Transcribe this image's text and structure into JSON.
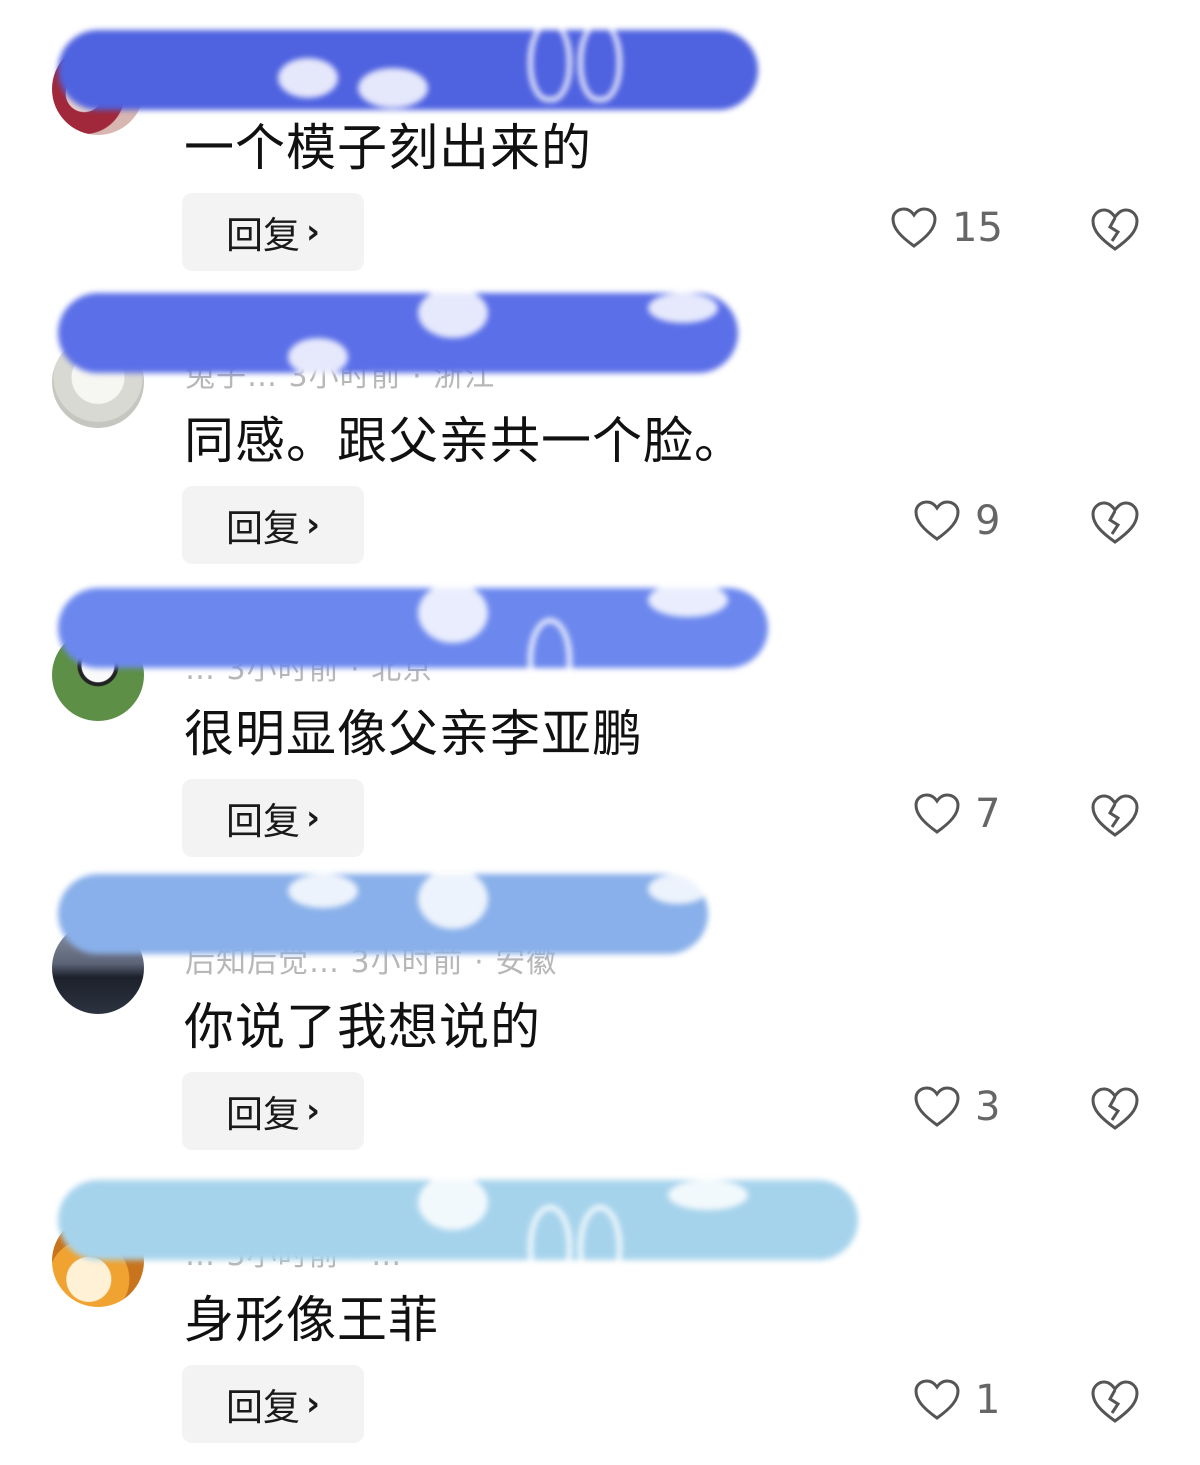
{
  "comments": [
    {
      "avatar_color": "#a0283a",
      "meta": "",
      "text": "一个模子刻出来的",
      "reply_label": "回复",
      "likes": "15",
      "scribble_color": "#4f62e0"
    },
    {
      "avatar_color": "#d9d9d4",
      "meta": "兔子…  3小时前 · 浙江",
      "text": "同感。跟父亲共一个脸。",
      "reply_label": "回复",
      "likes": "9",
      "scribble_color": "#5b6fe8"
    },
    {
      "avatar_color": "#5d8f46",
      "meta": "…  3小时前 · 北京",
      "text": "很明显像父亲李亚鹏",
      "reply_label": "回复",
      "likes": "7",
      "scribble_color": "#6c88ee"
    },
    {
      "avatar_color": "#2c3340",
      "meta": "后知后觉…  3小时前 · 安徽",
      "text": "你说了我想说的",
      "reply_label": "回复",
      "likes": "3",
      "scribble_color": "#89b0ea"
    },
    {
      "avatar_color": "#f0a331",
      "meta": "…  3小时前 · …",
      "text": "身形像王菲",
      "reply_label": "回复",
      "likes": "1",
      "scribble_color": "#a6d3ec"
    }
  ],
  "icons": {
    "like": "heart-outline-icon",
    "dislike": "broken-heart-icon",
    "chevron": "chevron-right-icon"
  }
}
